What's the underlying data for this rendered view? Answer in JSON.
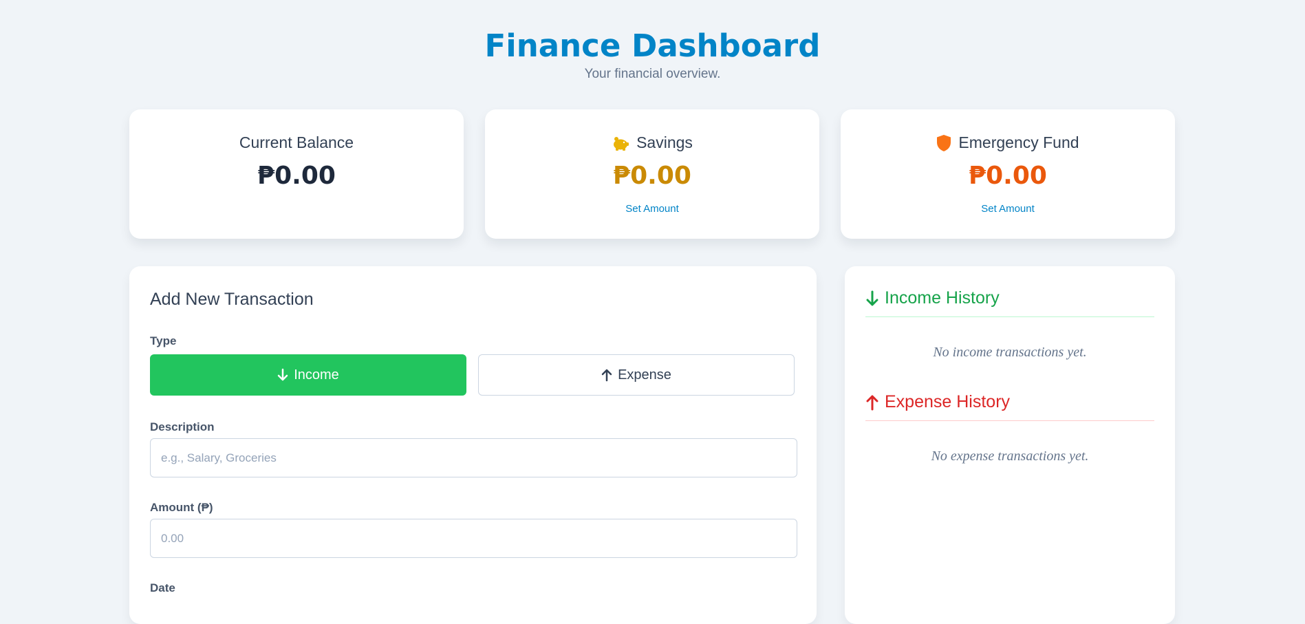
{
  "header": {
    "title": "Finance Dashboard",
    "subtitle": "Your financial overview."
  },
  "cards": {
    "balance": {
      "label": "Current Balance",
      "value": "₱0.00",
      "color": "#1e293b"
    },
    "savings": {
      "label": "Savings",
      "value": "₱0.00",
      "link": "Set Amount",
      "icon": "piggy-bank-icon",
      "color": "#ca8a04"
    },
    "emergency": {
      "label": "Emergency Fund",
      "value": "₱0.00",
      "link": "Set Amount",
      "icon": "shield-icon",
      "color": "#ea580c"
    }
  },
  "form": {
    "heading": "Add New Transaction",
    "type_label": "Type",
    "income_label": "Income",
    "expense_label": "Expense",
    "description_label": "Description",
    "description_placeholder": "e.g., Salary, Groceries",
    "amount_label": "Amount (₱)",
    "amount_placeholder": "0.00",
    "date_label": "Date"
  },
  "history": {
    "income_title": "Income History",
    "income_empty": "No income transactions yet.",
    "expense_title": "Expense History",
    "expense_empty": "No expense transactions yet."
  },
  "colors": {
    "accent": "#0284c7",
    "income": "#22c55e",
    "expense": "#dc2626"
  }
}
